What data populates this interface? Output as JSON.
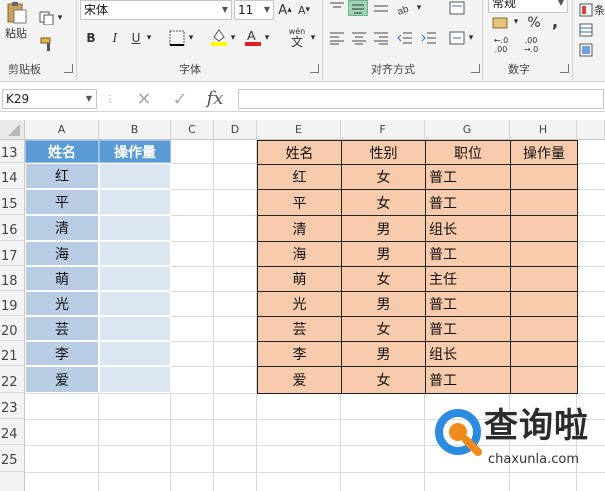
{
  "ribbon": {
    "clipboard": {
      "paste_label": "粘贴",
      "group_label": "剪贴板"
    },
    "font": {
      "name": "宋体",
      "size": "11",
      "bold": "B",
      "italic": "I",
      "underline": "U",
      "group_label": "字体",
      "wen_label": "wén",
      "wen_char": "文",
      "grow": "A",
      "shrink": "A"
    },
    "alignment": {
      "group_label": "对齐方式"
    },
    "number": {
      "format": "常规",
      "percent": "%",
      "comma": ",",
      "group_label": "数字",
      "inc_decimal": "←.0 .00",
      "dec_decimal": ".00 →.0"
    },
    "partial_right": "条"
  },
  "formula_bar": {
    "name_box": "K29",
    "cancel": "✕",
    "enter": "✓",
    "fx": "fx",
    "value": ""
  },
  "columns": [
    "A",
    "B",
    "C",
    "D",
    "E",
    "F",
    "G",
    "H"
  ],
  "rows": [
    "13",
    "14",
    "15",
    "16",
    "17",
    "18",
    "19",
    "20",
    "21",
    "22",
    "23",
    "24",
    "25"
  ],
  "table_left": {
    "headers": [
      "姓名",
      "操作量"
    ],
    "names": [
      "红",
      "平",
      "清",
      "海",
      "萌",
      "光",
      "芸",
      "李",
      "爱"
    ]
  },
  "table_right": {
    "headers": [
      "姓名",
      "性别",
      "职位",
      "操作量"
    ],
    "rows": [
      [
        "红",
        "女",
        "普工",
        ""
      ],
      [
        "平",
        "女",
        "普工",
        ""
      ],
      [
        "清",
        "男",
        "组长",
        ""
      ],
      [
        "海",
        "男",
        "普工",
        ""
      ],
      [
        "萌",
        "女",
        "主任",
        ""
      ],
      [
        "光",
        "男",
        "普工",
        ""
      ],
      [
        "芸",
        "女",
        "普工",
        ""
      ],
      [
        "李",
        "男",
        "组长",
        ""
      ],
      [
        "爱",
        "女",
        "普工",
        ""
      ]
    ]
  },
  "watermark": {
    "title": "查询啦",
    "url": "chaxunla.com",
    "color": "#2a8be0"
  }
}
